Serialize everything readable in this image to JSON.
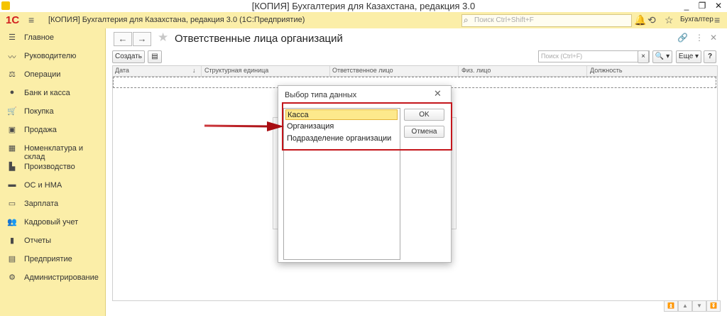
{
  "window": {
    "title": "[КОПИЯ] Бухгалтерия для Казахстана, редакция 3.0",
    "controls": [
      "_",
      "❐",
      "✕"
    ]
  },
  "topbar": {
    "logo": "1С",
    "app_title": "[КОПИЯ] Бухгалтерия для Казахстана, редакция 3.0  (1С:Предприятие)",
    "search_placeholder": "Поиск Ctrl+Shift+F",
    "user": "Бухгалтер"
  },
  "sidebar": {
    "items": [
      {
        "label": "Главное",
        "icon": "☰"
      },
      {
        "label": "Руководителю",
        "icon": "〰"
      },
      {
        "label": "Операции",
        "icon": "⚖"
      },
      {
        "label": "Банк и касса",
        "icon": "●"
      },
      {
        "label": "Покупка",
        "icon": "🛒"
      },
      {
        "label": "Продажа",
        "icon": "▣"
      },
      {
        "label": "Номенклатура и склад",
        "icon": "▦"
      },
      {
        "label": "Производство",
        "icon": "▙"
      },
      {
        "label": "ОС и НМА",
        "icon": "▬"
      },
      {
        "label": "Зарплата",
        "icon": "▭"
      },
      {
        "label": "Кадровый учет",
        "icon": "👥"
      },
      {
        "label": "Отчеты",
        "icon": "▮"
      },
      {
        "label": "Предприятие",
        "icon": "▤"
      },
      {
        "label": "Администрирование",
        "icon": "⚙"
      }
    ]
  },
  "content": {
    "page_title": "Ответственные лица организаций",
    "create_label": "Создать",
    "search_placeholder": "Поиск (Ctrl+F)",
    "clear_label": "×",
    "find_label": "🔍 ▾",
    "more_label": "Еще ▾",
    "help_label": "?",
    "columns": [
      "Дата",
      "Структурная единица",
      "Ответственное лицо",
      "Физ. лицо",
      "Должность"
    ],
    "sort_arrow": "↓"
  },
  "dialog": {
    "title": "Выбор типа данных",
    "close": "✕",
    "items": [
      "Касса",
      "Организация",
      "Подразделение организации"
    ],
    "selected_index": 0,
    "ok_label": "OK",
    "cancel_label": "Отмена"
  },
  "colors": {
    "panel_yellow": "#fbeea8",
    "selection_yellow": "#fde98c",
    "annotation_red": "#c4161c"
  }
}
